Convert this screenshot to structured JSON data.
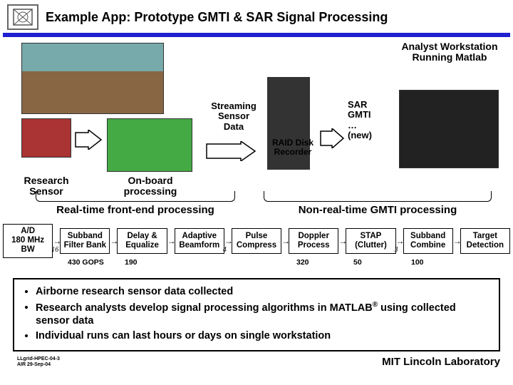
{
  "header": {
    "title": "Example App: Prototype GMTI & SAR Signal Processing"
  },
  "top": {
    "streaming_label": "Streaming\nSensor\nData",
    "raid_label": "RAID Disk\nRecorder",
    "analyst_label": "Analyst Workstation\nRunning Matlab",
    "sar_list": "SAR\nGMTI\n…\n(new)",
    "research_sensor": "Research\nSensor",
    "onboard": "On-board\nprocessing"
  },
  "sections": {
    "realtime": "Real-time front-end processing",
    "nonrealtime": "Non-real-time GMTI processing"
  },
  "pipeline": [
    {
      "lines": [
        "A/D",
        "180 MHz",
        "BW"
      ],
      "sub": "16"
    },
    {
      "lines": [
        "Subband",
        "Filter Bank"
      ],
      "gops": "430 GOPS"
    },
    {
      "lines": [
        "Delay &",
        "Equalize"
      ],
      "gops": "190"
    },
    {
      "lines": [
        "Adaptive",
        "Beamform"
      ],
      "sub": "4"
    },
    {
      "lines": [
        "Pulse",
        "Compress"
      ]
    },
    {
      "lines": [
        "Doppler",
        "Process"
      ],
      "gops": "320"
    },
    {
      "lines": [
        "STAP",
        "(Clutter)"
      ],
      "sub": "3",
      "gops": "50"
    },
    {
      "lines": [
        "Subband",
        "Combine"
      ],
      "gops": "100"
    },
    {
      "lines": [
        "Target",
        "Detection"
      ]
    }
  ],
  "bullets": [
    "Airborne research sensor data collected",
    "Research analysts develop signal processing algorithms in MATLAB® using collected sensor data",
    "Individual runs can last hours or days on single workstation"
  ],
  "footer": {
    "left_line1": "LLgrid-HPEC-04-3",
    "left_line2": "AIR 29-Sep-04",
    "right": "MIT Lincoln Laboratory"
  }
}
